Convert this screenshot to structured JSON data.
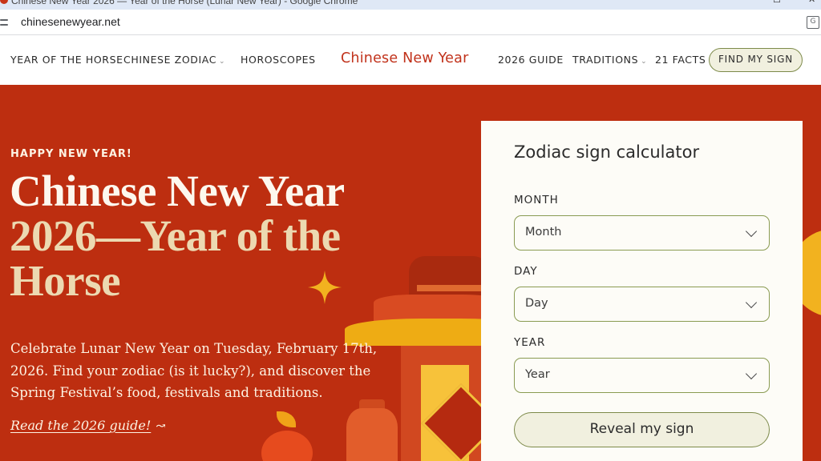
{
  "browser": {
    "tab_title": "Chinese New Year 2026 — Year of the Horse (Lunar New Year) - Google Chrome",
    "url": "chinesenewyear.net"
  },
  "nav": {
    "items_left": [
      {
        "label": "YEAR OF THE HORSE"
      },
      {
        "label": "CHINESE ZODIAC",
        "dropdown": true
      },
      {
        "label": "HOROSCOPES"
      }
    ],
    "brand": "Chinese New Year",
    "items_right": [
      {
        "label": "2026 GUIDE"
      },
      {
        "label": "TRADITIONS",
        "dropdown": true
      },
      {
        "label": "21 FACTS"
      }
    ],
    "cta": "FIND MY SIGN"
  },
  "hero": {
    "kicker": "HAPPY NEW YEAR!",
    "title_lines": [
      "Chinese New Year",
      "2026—Year of the",
      "Horse"
    ],
    "description": "Celebrate Lunar New Year on Tuesday, February 17th, 2026. Find your zodiac (is it lucky?), and discover the Spring Festival’s food, festivals and traditions.",
    "link": "Read the 2026 guide!"
  },
  "calculator": {
    "title": "Zodiac sign calculator",
    "fields": [
      {
        "label": "MONTH",
        "value": "Month"
      },
      {
        "label": "DAY",
        "value": "Day"
      },
      {
        "label": "YEAR",
        "value": "Year"
      }
    ],
    "submit": "Reveal my sign"
  },
  "colors": {
    "brand_red": "#c1321b",
    "hero_bg": "#bd2e10",
    "accent_olive": "#8a9b52",
    "button_cream": "#f1f0df",
    "hero_gold": "#f2b21f"
  }
}
